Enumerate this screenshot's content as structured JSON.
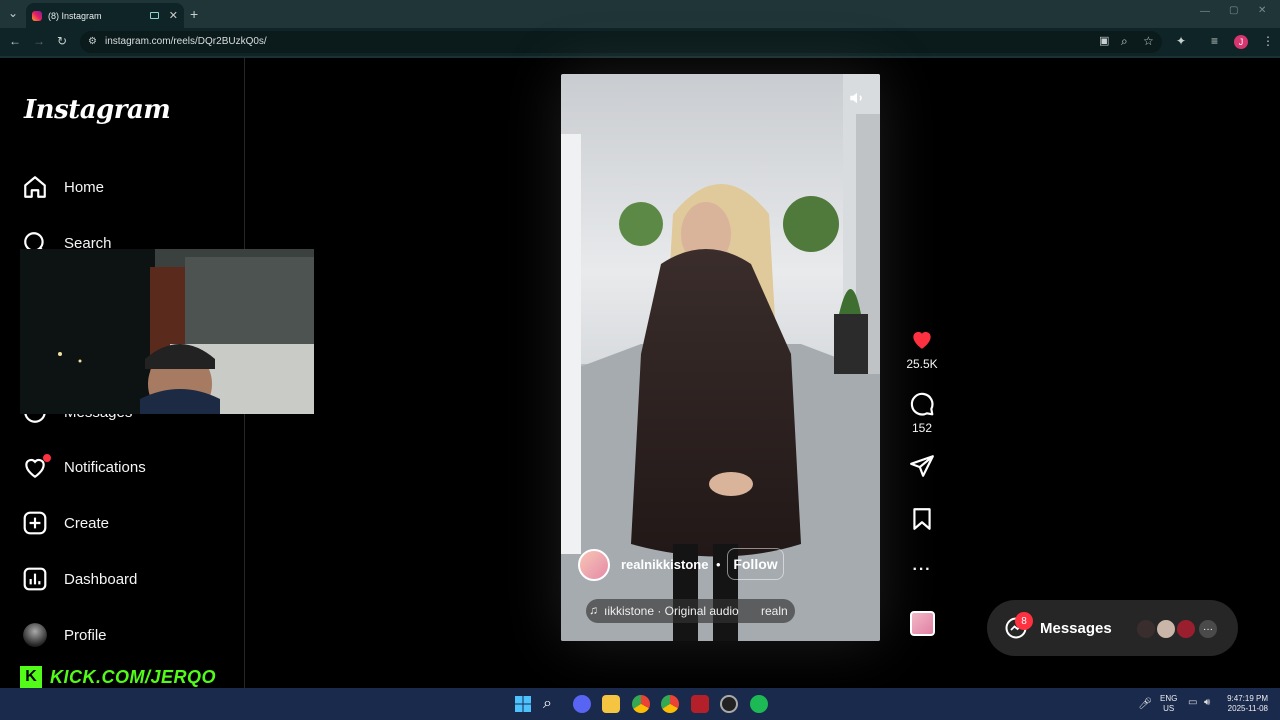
{
  "browser": {
    "tab_title": "(8) Instagram",
    "url": "instagram.com/reels/DQr2BUzkQ0s/",
    "profile_initial": "J"
  },
  "sidebar": {
    "logo": "Instagram",
    "items": [
      {
        "label": "Home",
        "icon": "home-icon"
      },
      {
        "label": "Search",
        "icon": "search-icon"
      },
      {
        "label": "Messages",
        "icon": "messenger-icon"
      },
      {
        "label": "Notifications",
        "icon": "heart-icon"
      },
      {
        "label": "Create",
        "icon": "plus-square-icon"
      },
      {
        "label": "Dashboard",
        "icon": "dashboard-icon"
      },
      {
        "label": "Profile",
        "icon": "avatar-icon"
      }
    ]
  },
  "overlay": {
    "kick_text": "KICK.COM/JERQO"
  },
  "reel": {
    "username": "realnikkistone",
    "follow_label": "Follow",
    "separator": "•",
    "audio_text": "ıikkistone · Original audio",
    "audio_text_trailing": "realn",
    "likes": "25.5K",
    "comments": "152"
  },
  "messages": {
    "label": "Messages",
    "badge": "8"
  },
  "taskbar": {
    "lang_top": "ENG",
    "lang_bottom": "US",
    "time": "9:47:19 PM",
    "date": "2025-11-08"
  },
  "colors": {
    "accent_red": "#ff3040",
    "kick_green": "#53fc18",
    "chrome_bg": "#0f2426"
  }
}
